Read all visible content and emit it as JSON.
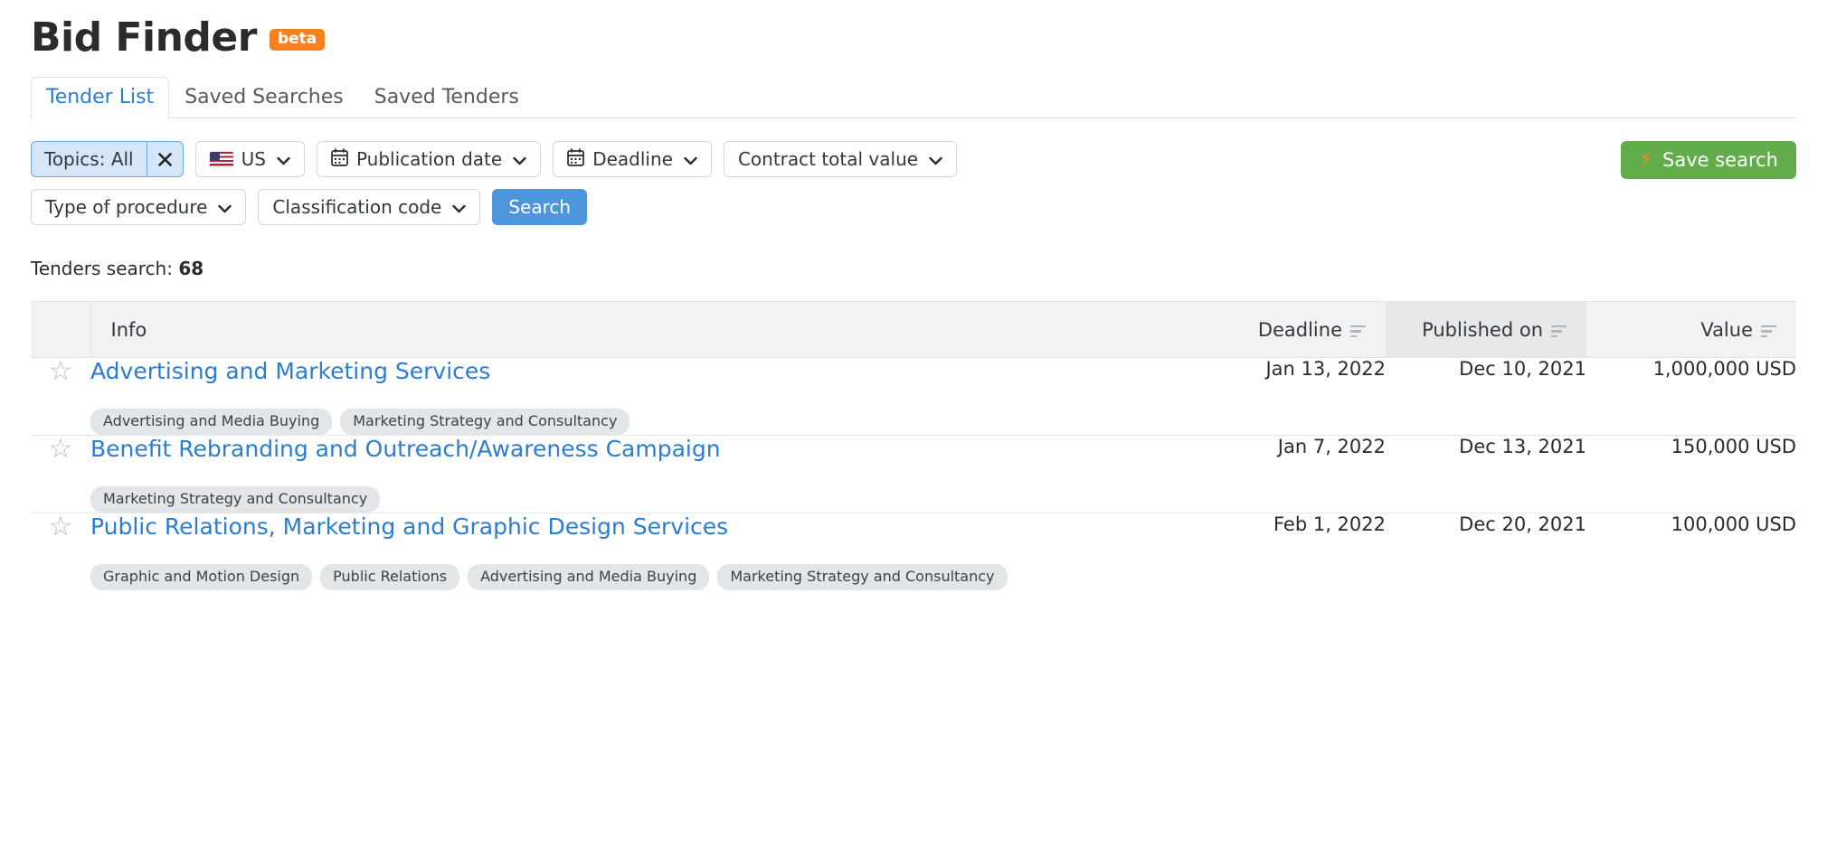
{
  "header": {
    "title": "Bid Finder",
    "badge": "beta"
  },
  "tabs": [
    {
      "label": "Tender List",
      "active": true
    },
    {
      "label": "Saved Searches",
      "active": false
    },
    {
      "label": "Saved Tenders",
      "active": false
    }
  ],
  "filters": {
    "topics": {
      "label": "Topics: All",
      "clear_icon": "close-icon"
    },
    "country": {
      "label": "US",
      "icon": "us-flag-icon"
    },
    "publication_date": {
      "label": "Publication date",
      "icon": "calendar-icon"
    },
    "deadline": {
      "label": "Deadline",
      "icon": "calendar-icon"
    },
    "contract_total_value": {
      "label": "Contract total value"
    },
    "type_of_procedure": {
      "label": "Type of procedure"
    },
    "classification_code": {
      "label": "Classification code"
    },
    "search_button": "Search",
    "save_search_button": "Save search",
    "save_search_icon": "lightning-bolt-icon",
    "caret_icon": "chevron-down-icon"
  },
  "results": {
    "count_label": "Tenders search:",
    "count_value": "68"
  },
  "table": {
    "columns": {
      "info": "Info",
      "deadline": "Deadline",
      "published": "Published on",
      "value": "Value"
    },
    "sort_icon": "sort-icon",
    "star_icon": "star-outline-icon",
    "rows": [
      {
        "title": "Advertising and Marketing Services",
        "tags": [
          "Advertising and Media Buying",
          "Marketing Strategy and Consultancy"
        ],
        "deadline": "Jan 13, 2022",
        "published": "Dec 10, 2021",
        "value": "1,000,000 USD"
      },
      {
        "title": "Benefit Rebranding and Outreach/Awareness Campaign",
        "tags": [
          "Marketing Strategy and Consultancy"
        ],
        "deadline": "Jan 7, 2022",
        "published": "Dec 13, 2021",
        "value": "150,000 USD"
      },
      {
        "title": "Public Relations, Marketing and Graphic Design Services",
        "tags": [
          "Graphic and Motion Design",
          "Public Relations",
          "Advertising and Media Buying",
          "Marketing Strategy and Consultancy"
        ],
        "deadline": "Feb 1, 2022",
        "published": "Dec 20, 2021",
        "value": "100,000 USD"
      }
    ]
  },
  "colors": {
    "accent_blue": "#2b7cd3",
    "button_blue": "#4d96db",
    "green": "#63ac4b",
    "orange": "#f5821f",
    "topics_fill": "#d4e6f8"
  }
}
